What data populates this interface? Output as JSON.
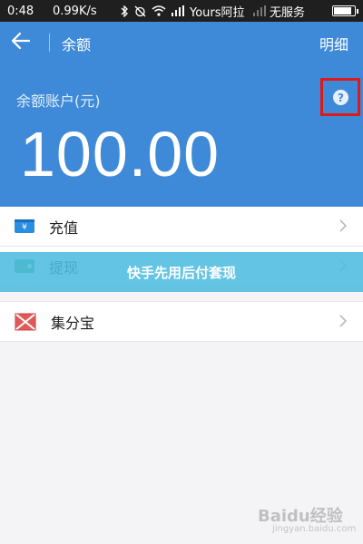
{
  "status_bar": {
    "time": "0:48",
    "net_speed": "0.99K/s",
    "carrier_1": "Yours阿拉",
    "carrier_2": "无服务",
    "battery_level": 0.9
  },
  "nav": {
    "title": "余额",
    "detail_label": "明细"
  },
  "balance": {
    "label": "余额账户(元)",
    "amount": "100.00",
    "help_glyph": "?"
  },
  "menu": [
    {
      "label": "充值",
      "icon": "recharge-card-icon",
      "icon_text": "¥"
    },
    {
      "label": "提现",
      "icon": "wallet-icon"
    },
    {
      "label": "集分宝",
      "icon": "jifenbao-icon"
    }
  ],
  "banner": {
    "text": "快手先用后付套现"
  },
  "watermark": {
    "text": "Baidu经验",
    "sub": "jingyan.baidu.com"
  },
  "colors": {
    "header_blue": "#3e8ad8",
    "highlight_red": "#e01818",
    "banner_cyan": "#4ebce0"
  }
}
